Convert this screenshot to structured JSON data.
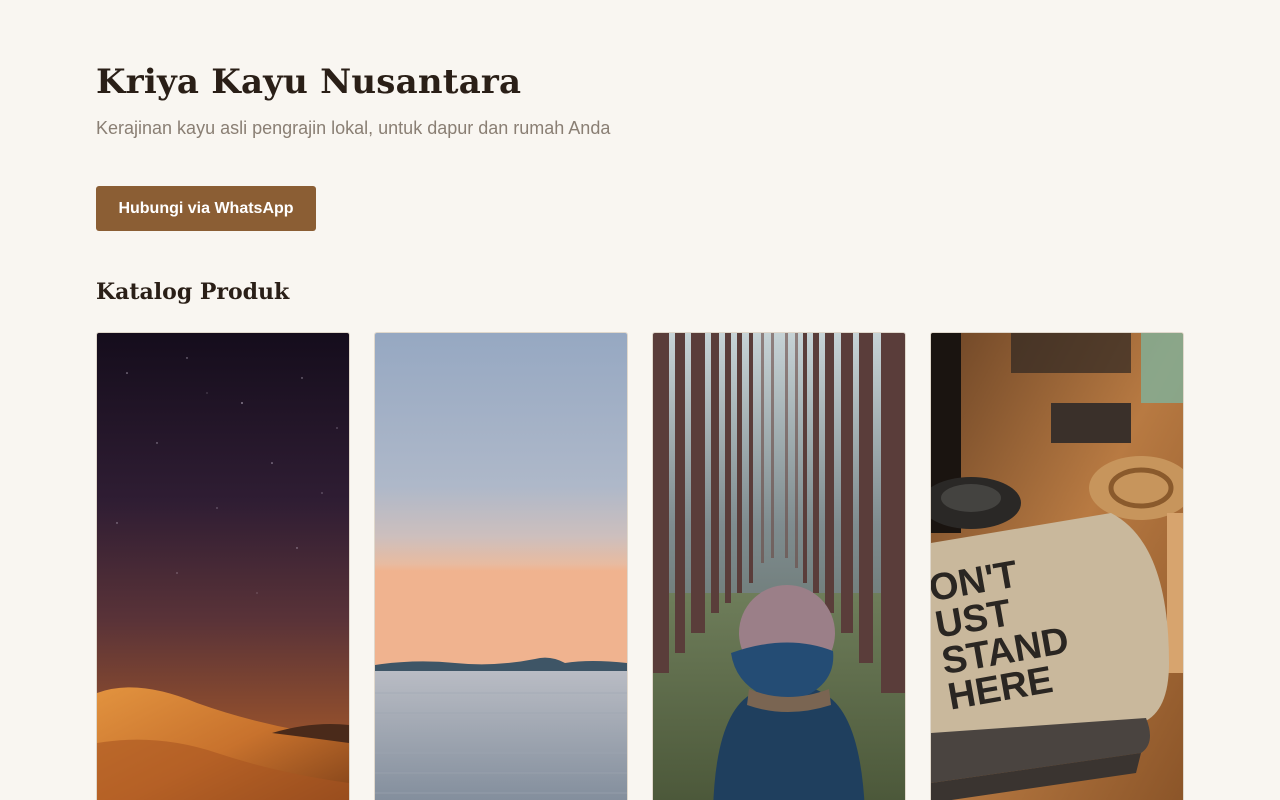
{
  "header": {
    "title": "Kriya Kayu Nusantara",
    "tagline": "Kerajinan kayu asli pengrajin lokal, untuk dapur dan rumah Anda"
  },
  "cta": {
    "label": "Hubungi via WhatsApp"
  },
  "catalog": {
    "heading": "Katalog Produk",
    "products": [
      {
        "image": "desert-night-photo"
      },
      {
        "image": "lake-sunset-photo"
      },
      {
        "image": "forest-person-photo"
      },
      {
        "image": "notebook-desk-photo",
        "image_text": "DON'T JUST STAND THERE"
      }
    ]
  },
  "colors": {
    "background": "#f9f6f1",
    "accent": "#8b5e34",
    "title": "#2a1f17",
    "muted": "#8a7f74"
  }
}
